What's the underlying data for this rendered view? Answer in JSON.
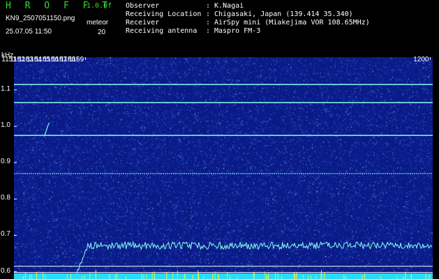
{
  "header": {
    "app_name": "H R O F F T",
    "version": "1.0.0f",
    "filename": "KN9_2507051150.png",
    "datetime": "25.07.05 11:50",
    "meteor_label": "meteor",
    "meteor_count": "20"
  },
  "info": [
    {
      "key": "Observer",
      "value": "K.Nagai"
    },
    {
      "key": "Receiving Location",
      "value": "Chigasaki, Japan (139.414 35.340)"
    },
    {
      "key": "Receiver",
      "value": "AirSpy mini (Miakejima VOR 108.65MHz)"
    },
    {
      "key": "Receiving antenna",
      "value": "Maspro FM-3"
    }
  ],
  "spectrogram": {
    "y_unit": "kHz",
    "y_ticks": [
      "1.1",
      "1.0",
      "0.9",
      "0.8",
      "0.7",
      "0.6"
    ],
    "x_ticks": [
      "1151",
      "1152",
      "1153",
      "1154",
      "1155",
      "1156",
      "1157",
      "1158",
      "1159",
      "1200"
    ],
    "y_range": [
      0.58,
      1.19
    ],
    "x_range": [
      1150.5,
      1200.3
    ],
    "horizontal_lines_khz": [
      1.115,
      1.065,
      0.975,
      0.87
    ],
    "lower_band_lines_khz": [
      0.615,
      0.598
    ],
    "colors": {
      "background": "#0a1a86",
      "noise": "#3a7cff",
      "signal": "#88ffee",
      "bottom_band": "#22ddff",
      "meteor_ticks": "#ffee33",
      "border_line": "#ffffff"
    }
  }
}
